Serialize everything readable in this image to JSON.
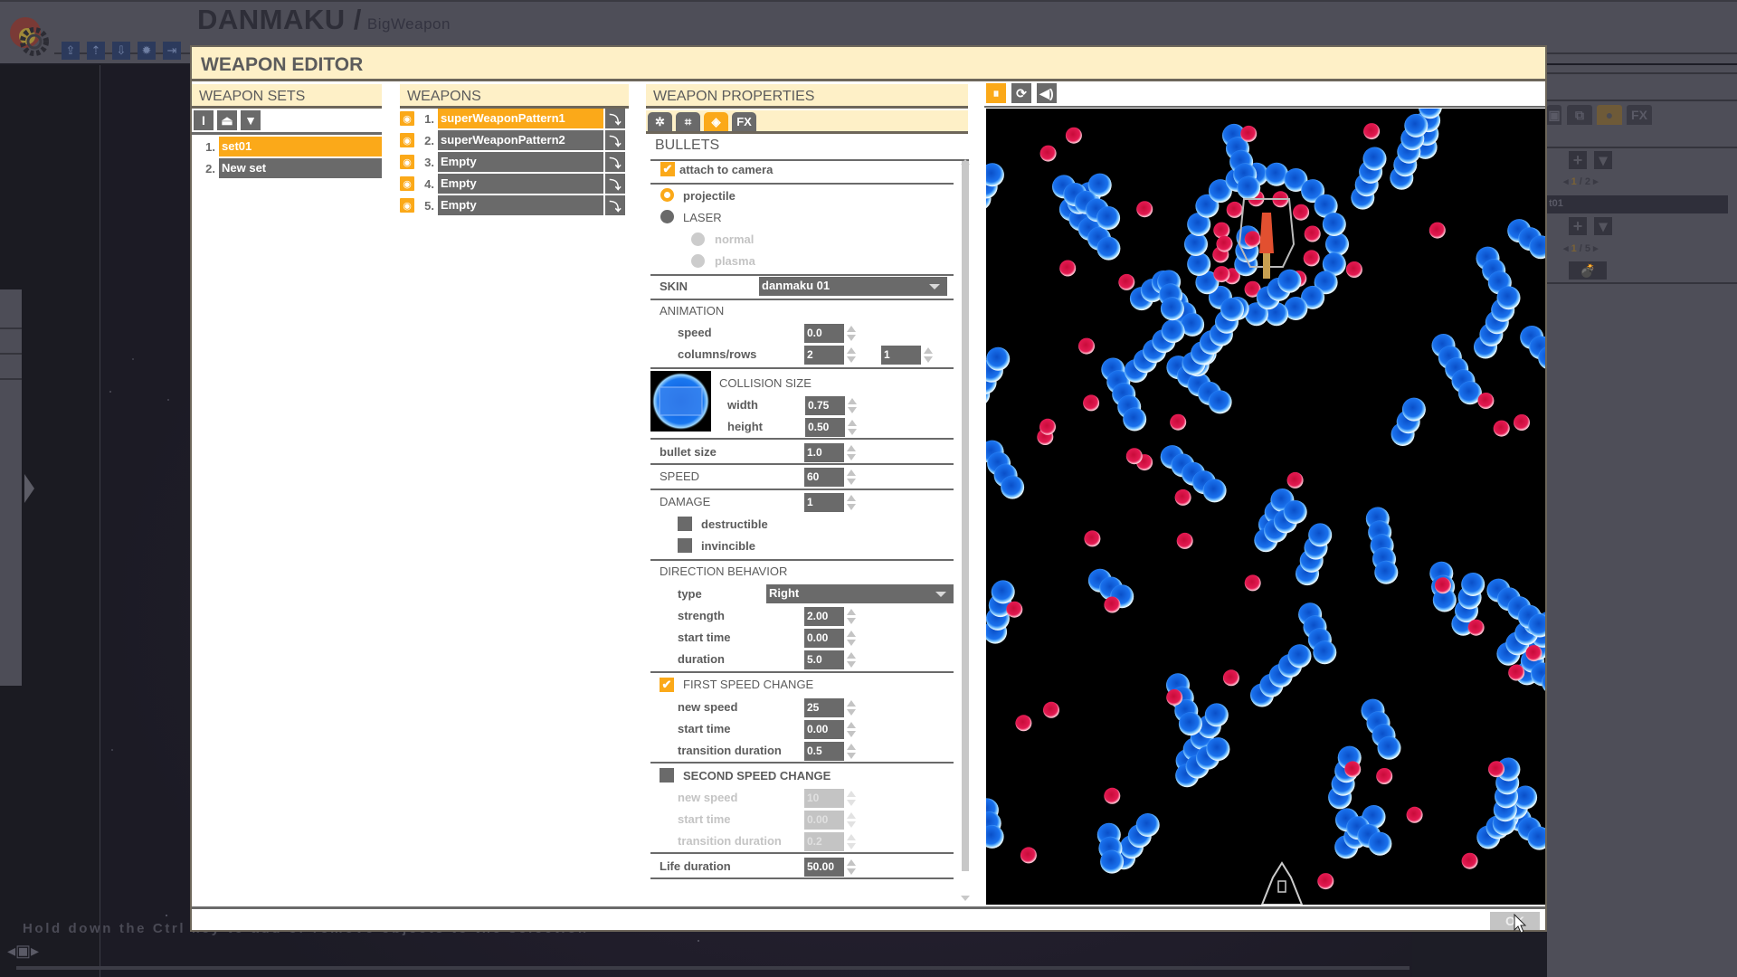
{
  "app": {
    "title": "DANMAKU /",
    "subtitle": "BigWeapon",
    "toolbar_icons": [
      "export-icon",
      "import-icon",
      "download-icon",
      "settings-gear-icon",
      "exit-icon"
    ],
    "hint": "Hold down the Ctrl key to add or remove objects to the selection",
    "right_panel": {
      "tabs": [
        "▣",
        "⧉",
        "●",
        "FX"
      ],
      "pager1": {
        "current": "1",
        "total": "/ 2"
      },
      "row_label": "t01",
      "pager2": {
        "current": "1",
        "total": "/ 5"
      }
    }
  },
  "dialog": {
    "title": "WEAPON EDITOR",
    "weapon_sets": {
      "header": "WEAPON SETS",
      "tools": [
        "rename",
        "move-up",
        "move-down"
      ],
      "items": [
        {
          "num": "1.",
          "label": "set01",
          "selected": true
        },
        {
          "num": "2.",
          "label": "New set",
          "selected": false
        }
      ]
    },
    "weapons": {
      "header": "WEAPONS",
      "items": [
        {
          "num": "1.",
          "label": "superWeaponPattern1",
          "selected": true
        },
        {
          "num": "2.",
          "label": "superWeaponPattern2",
          "selected": false
        },
        {
          "num": "3.",
          "label": "Empty",
          "selected": false
        },
        {
          "num": "4.",
          "label": "Empty",
          "selected": false
        },
        {
          "num": "5.",
          "label": "Empty",
          "selected": false
        }
      ]
    },
    "properties": {
      "header": "WEAPON PROPERTIES",
      "tabs": [
        {
          "icon": "brain-icon",
          "glyph": "✲",
          "active": false
        },
        {
          "icon": "pattern-icon",
          "glyph": "⌗",
          "active": false
        },
        {
          "icon": "bullet-icon",
          "glyph": "◈",
          "active": true
        },
        {
          "icon": "fx-icon",
          "glyph": "FX",
          "active": false
        }
      ],
      "section": "BULLETS",
      "attach_to_camera": {
        "label": "attach to camera",
        "checked": true
      },
      "type_projectile": {
        "label": "projectile",
        "selected": true
      },
      "type_laser": {
        "label": "LASER",
        "selected": false
      },
      "laser_normal": "normal",
      "laser_plasma": "plasma",
      "skin": {
        "label": "SKIN",
        "value": "danmaku 01"
      },
      "animation": {
        "label": "ANIMATION",
        "speed_label": "speed",
        "speed": "0.0",
        "colrows_label": "columns/rows",
        "columns": "2",
        "rows": "1"
      },
      "collision": {
        "label": "COLLISION SIZE",
        "width_label": "width",
        "width": "0.75",
        "height_label": "height",
        "height": "0.50"
      },
      "bullet_size": {
        "label": "bullet size",
        "value": "1.0"
      },
      "speed": {
        "label": "SPEED",
        "value": "60"
      },
      "damage": {
        "label": "DAMAGE",
        "value": "1"
      },
      "destructible": {
        "label": "destructible",
        "checked": false
      },
      "invincible": {
        "label": "invincible",
        "checked": false
      },
      "direction": {
        "label": "DIRECTION BEHAVIOR",
        "type_label": "type",
        "type": "Right",
        "strength_label": "strength",
        "strength": "2.00",
        "start_label": "start time",
        "start": "0.00",
        "duration_label": "duration",
        "duration": "5.0"
      },
      "first_speed_change": {
        "label": "FIRST SPEED CHANGE",
        "checked": true,
        "new_speed_label": "new speed",
        "new_speed": "25",
        "start_label": "start time",
        "start": "0.00",
        "transition_label": "transition duration",
        "transition": "0.5"
      },
      "second_speed_change": {
        "label": "SECOND SPEED CHANGE",
        "checked": false,
        "new_speed_label": "new speed",
        "new_speed": "10",
        "start_label": "start time",
        "start": "0.00",
        "transition_label": "transition duration",
        "transition": "0.2"
      },
      "life_duration": {
        "label": "Life duration",
        "value": "50.00"
      }
    },
    "preview": {
      "controls": [
        {
          "icon": "pause-icon",
          "glyph": "⏸",
          "active": true
        },
        {
          "icon": "refresh-icon",
          "glyph": "⟳",
          "active": false
        },
        {
          "icon": "sound-icon",
          "glyph": "🔊",
          "active": false
        }
      ]
    },
    "ok_label": "OK"
  },
  "colors": {
    "accent": "#fba919",
    "header_bg": "#fef0c7",
    "control_gray": "#6a6a6a",
    "bullet_blue": "#1a6ee8",
    "bullet_red": "#e0174f"
  }
}
